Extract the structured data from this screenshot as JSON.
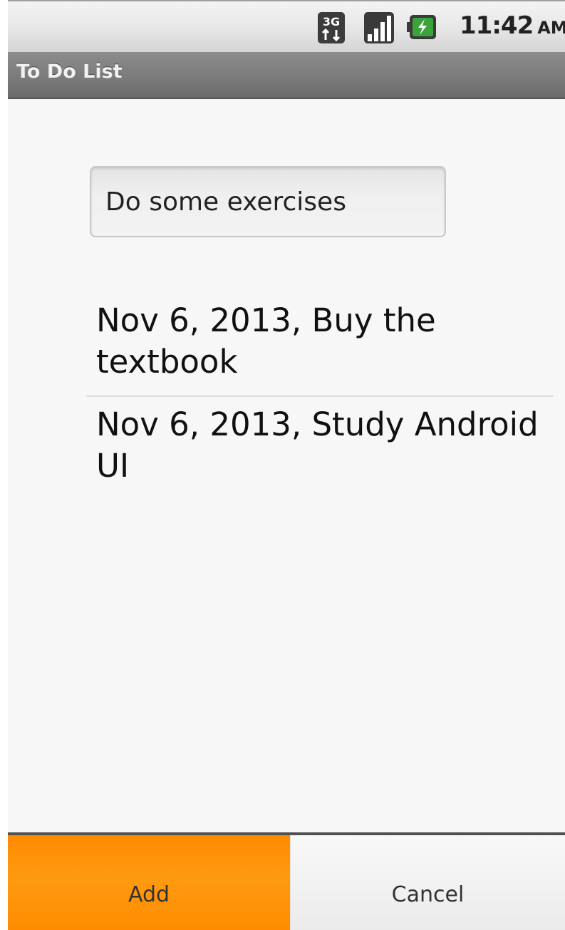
{
  "status_bar": {
    "time": "11:42",
    "ampm": "AM",
    "network_icon": "3g-data-icon",
    "signal_icon": "signal-strength-icon",
    "battery_icon": "battery-charging-icon"
  },
  "title_bar": {
    "title": "To Do List"
  },
  "task_input": {
    "value": "Do some exercises"
  },
  "todo_list": {
    "items": [
      {
        "label": "Nov 6, 2013, Buy the textbook"
      },
      {
        "label": "Nov 6, 2013, Study Android UI"
      }
    ]
  },
  "buttons": {
    "add_label": "Add",
    "cancel_label": "Cancel"
  },
  "colors": {
    "accent_orange": "#ff8c00",
    "title_bar_gray": "#7a7a7a",
    "battery_green": "#3aa33a"
  }
}
